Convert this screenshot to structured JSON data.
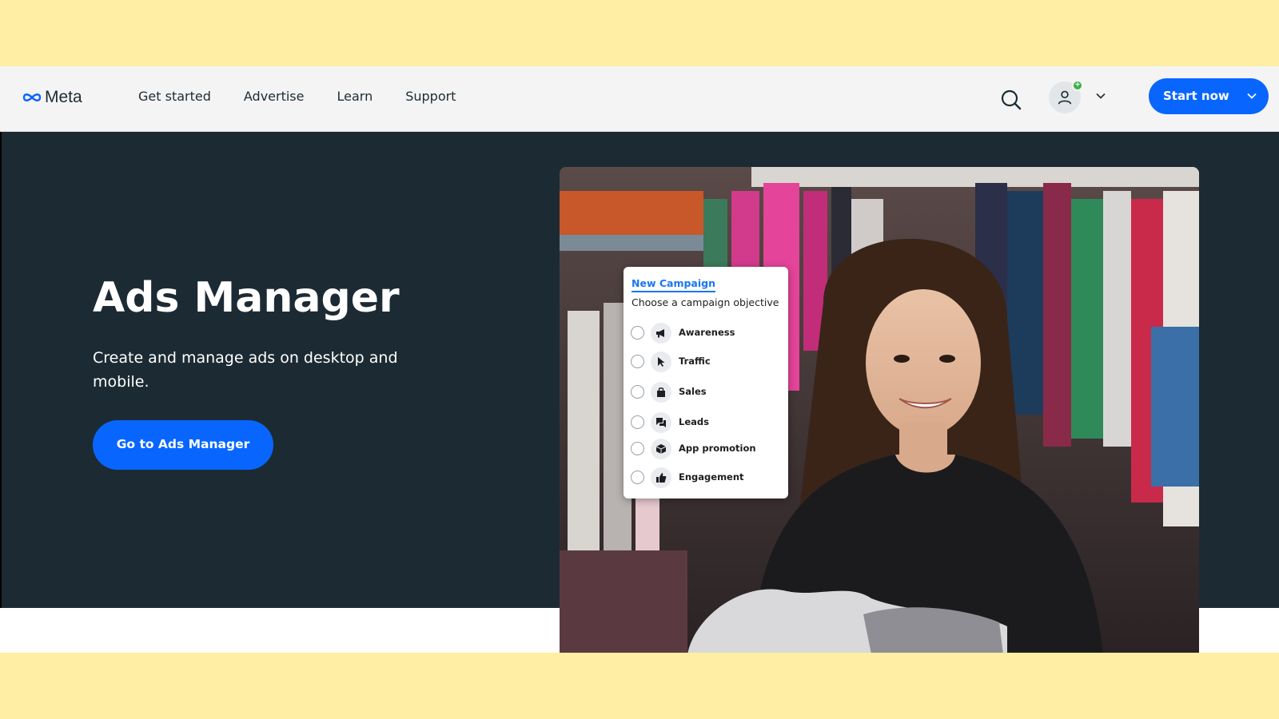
{
  "brand": {
    "logo_text": "Meta"
  },
  "nav": {
    "items": [
      {
        "label": "Get started"
      },
      {
        "label": "Advertise"
      },
      {
        "label": "Learn"
      },
      {
        "label": "Support"
      }
    ]
  },
  "header_actions": {
    "search_icon": "search-icon",
    "account_icon": "person-icon",
    "account_badge": "+",
    "start_button": "Start now"
  },
  "hero": {
    "title": "Ads Manager",
    "subtitle": "Create and manage ads on desktop and mobile.",
    "cta": "Go to Ads Manager"
  },
  "campaign_card": {
    "title": "New Campaign",
    "subtitle": "Choose a campaign objective",
    "options": [
      {
        "label": "Awareness",
        "icon": "megaphone-icon"
      },
      {
        "label": "Traffic",
        "icon": "cursor-icon"
      },
      {
        "label": "Sales",
        "icon": "shopping-bag-icon"
      },
      {
        "label": "Leads",
        "icon": "chat-bubbles-icon"
      },
      {
        "label": "App promotion",
        "icon": "box-icon"
      },
      {
        "label": "Engagement",
        "icon": "thumbs-up-icon"
      }
    ]
  },
  "colors": {
    "accent": "#0866ff",
    "hero_background": "#1c2b33",
    "header_background": "#f4f4f4",
    "frame_background": "#ffeea3",
    "badge_green": "#3cb24a"
  }
}
